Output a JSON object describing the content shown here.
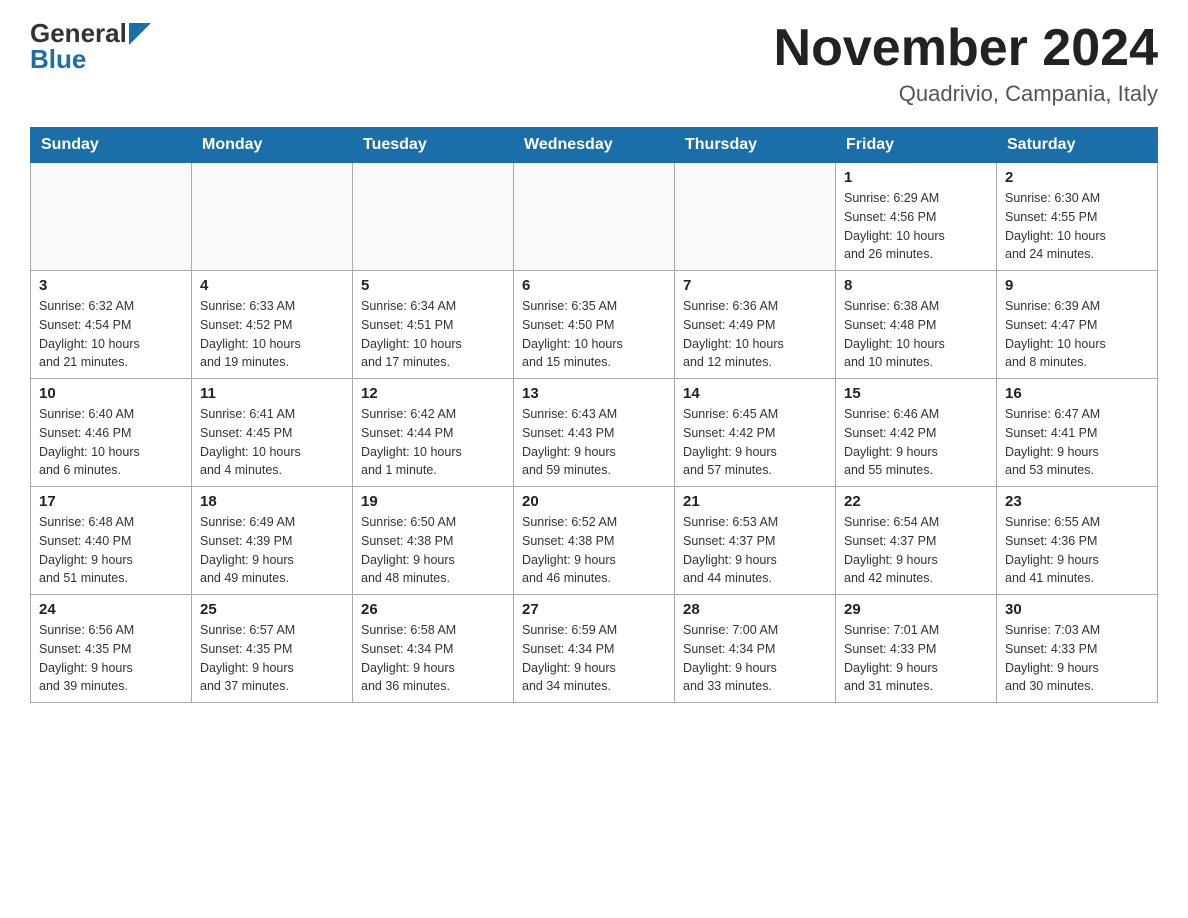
{
  "header": {
    "logo_general": "General",
    "logo_blue": "Blue",
    "month_title": "November 2024",
    "location": "Quadrivio, Campania, Italy"
  },
  "days_of_week": [
    "Sunday",
    "Monday",
    "Tuesday",
    "Wednesday",
    "Thursday",
    "Friday",
    "Saturday"
  ],
  "weeks": [
    [
      {
        "day": "",
        "info": ""
      },
      {
        "day": "",
        "info": ""
      },
      {
        "day": "",
        "info": ""
      },
      {
        "day": "",
        "info": ""
      },
      {
        "day": "",
        "info": ""
      },
      {
        "day": "1",
        "info": "Sunrise: 6:29 AM\nSunset: 4:56 PM\nDaylight: 10 hours\nand 26 minutes."
      },
      {
        "day": "2",
        "info": "Sunrise: 6:30 AM\nSunset: 4:55 PM\nDaylight: 10 hours\nand 24 minutes."
      }
    ],
    [
      {
        "day": "3",
        "info": "Sunrise: 6:32 AM\nSunset: 4:54 PM\nDaylight: 10 hours\nand 21 minutes."
      },
      {
        "day": "4",
        "info": "Sunrise: 6:33 AM\nSunset: 4:52 PM\nDaylight: 10 hours\nand 19 minutes."
      },
      {
        "day": "5",
        "info": "Sunrise: 6:34 AM\nSunset: 4:51 PM\nDaylight: 10 hours\nand 17 minutes."
      },
      {
        "day": "6",
        "info": "Sunrise: 6:35 AM\nSunset: 4:50 PM\nDaylight: 10 hours\nand 15 minutes."
      },
      {
        "day": "7",
        "info": "Sunrise: 6:36 AM\nSunset: 4:49 PM\nDaylight: 10 hours\nand 12 minutes."
      },
      {
        "day": "8",
        "info": "Sunrise: 6:38 AM\nSunset: 4:48 PM\nDaylight: 10 hours\nand 10 minutes."
      },
      {
        "day": "9",
        "info": "Sunrise: 6:39 AM\nSunset: 4:47 PM\nDaylight: 10 hours\nand 8 minutes."
      }
    ],
    [
      {
        "day": "10",
        "info": "Sunrise: 6:40 AM\nSunset: 4:46 PM\nDaylight: 10 hours\nand 6 minutes."
      },
      {
        "day": "11",
        "info": "Sunrise: 6:41 AM\nSunset: 4:45 PM\nDaylight: 10 hours\nand 4 minutes."
      },
      {
        "day": "12",
        "info": "Sunrise: 6:42 AM\nSunset: 4:44 PM\nDaylight: 10 hours\nand 1 minute."
      },
      {
        "day": "13",
        "info": "Sunrise: 6:43 AM\nSunset: 4:43 PM\nDaylight: 9 hours\nand 59 minutes."
      },
      {
        "day": "14",
        "info": "Sunrise: 6:45 AM\nSunset: 4:42 PM\nDaylight: 9 hours\nand 57 minutes."
      },
      {
        "day": "15",
        "info": "Sunrise: 6:46 AM\nSunset: 4:42 PM\nDaylight: 9 hours\nand 55 minutes."
      },
      {
        "day": "16",
        "info": "Sunrise: 6:47 AM\nSunset: 4:41 PM\nDaylight: 9 hours\nand 53 minutes."
      }
    ],
    [
      {
        "day": "17",
        "info": "Sunrise: 6:48 AM\nSunset: 4:40 PM\nDaylight: 9 hours\nand 51 minutes."
      },
      {
        "day": "18",
        "info": "Sunrise: 6:49 AM\nSunset: 4:39 PM\nDaylight: 9 hours\nand 49 minutes."
      },
      {
        "day": "19",
        "info": "Sunrise: 6:50 AM\nSunset: 4:38 PM\nDaylight: 9 hours\nand 48 minutes."
      },
      {
        "day": "20",
        "info": "Sunrise: 6:52 AM\nSunset: 4:38 PM\nDaylight: 9 hours\nand 46 minutes."
      },
      {
        "day": "21",
        "info": "Sunrise: 6:53 AM\nSunset: 4:37 PM\nDaylight: 9 hours\nand 44 minutes."
      },
      {
        "day": "22",
        "info": "Sunrise: 6:54 AM\nSunset: 4:37 PM\nDaylight: 9 hours\nand 42 minutes."
      },
      {
        "day": "23",
        "info": "Sunrise: 6:55 AM\nSunset: 4:36 PM\nDaylight: 9 hours\nand 41 minutes."
      }
    ],
    [
      {
        "day": "24",
        "info": "Sunrise: 6:56 AM\nSunset: 4:35 PM\nDaylight: 9 hours\nand 39 minutes."
      },
      {
        "day": "25",
        "info": "Sunrise: 6:57 AM\nSunset: 4:35 PM\nDaylight: 9 hours\nand 37 minutes."
      },
      {
        "day": "26",
        "info": "Sunrise: 6:58 AM\nSunset: 4:34 PM\nDaylight: 9 hours\nand 36 minutes."
      },
      {
        "day": "27",
        "info": "Sunrise: 6:59 AM\nSunset: 4:34 PM\nDaylight: 9 hours\nand 34 minutes."
      },
      {
        "day": "28",
        "info": "Sunrise: 7:00 AM\nSunset: 4:34 PM\nDaylight: 9 hours\nand 33 minutes."
      },
      {
        "day": "29",
        "info": "Sunrise: 7:01 AM\nSunset: 4:33 PM\nDaylight: 9 hours\nand 31 minutes."
      },
      {
        "day": "30",
        "info": "Sunrise: 7:03 AM\nSunset: 4:33 PM\nDaylight: 9 hours\nand 30 minutes."
      }
    ]
  ]
}
